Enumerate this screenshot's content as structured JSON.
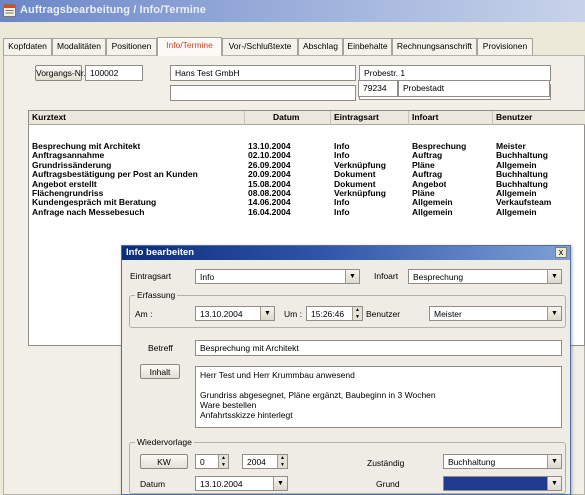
{
  "window": {
    "title": "Auftragsbearbeitung / Info/Termine"
  },
  "tabs": [
    {
      "label": "Kopfdaten"
    },
    {
      "label": "Modalitäten"
    },
    {
      "label": "Positionen"
    },
    {
      "label": "Info/Termine"
    },
    {
      "label": "Vor-/Schlußtexte"
    },
    {
      "label": "Abschlag"
    },
    {
      "label": "Einbehalte"
    },
    {
      "label": "Rechnungsanschrift"
    },
    {
      "label": "Provisionen"
    }
  ],
  "header": {
    "vorgang_button": "Vorgangs-Nr.",
    "vorgang_number": "100002",
    "customer_name": "Hans Test GmbH",
    "customer_line2": "",
    "street": "Probestr. 1",
    "street2": "",
    "zip": "79234",
    "city": "Probestadt"
  },
  "list": {
    "columns": [
      "Kurztext",
      "Datum",
      "Eintragsart",
      "Infoart",
      "Benutzer"
    ],
    "rows": [
      [
        "Besprechung mit Architekt",
        "13.10.2004",
        "Info",
        "Besprechung",
        "Meister"
      ],
      [
        "Anftragsannahme",
        "02.10.2004",
        "Info",
        "Auftrag",
        "Buchhaltung"
      ],
      [
        "Grundrissänderung",
        "26.09.2004",
        "Verknüpfung",
        "Pläne",
        "Allgemein"
      ],
      [
        "Auftragsbestätigung per Post an Kunden",
        "20.09.2004",
        "Dokument",
        "Auftrag",
        "Buchhaltung"
      ],
      [
        "Angebot erstellt",
        "15.08.2004",
        "Dokument",
        "Angebot",
        "Buchhaltung"
      ],
      [
        "Flächengrundriss",
        "08.08.2004",
        "Verknüpfung",
        "Pläne",
        "Allgemein"
      ],
      [
        "Kundengespräch mit Beratung",
        "14.06.2004",
        "Info",
        "Allgemein",
        "Verkaufsteam"
      ],
      [
        "Anfrage nach Messebesuch",
        "16.04.2004",
        "Info",
        "Allgemein",
        "Allgemein"
      ]
    ]
  },
  "dialog": {
    "title": "Info bearbeiten",
    "close": "x",
    "eintragsart_label": "Eintragsart",
    "eintragsart_value": "Info",
    "infoart_label": "Infoart",
    "infoart_value": "Besprechung",
    "erfassung_title": "Erfassung",
    "am_label": "Am :",
    "am_value": "13.10.2004",
    "um_label": "Um :",
    "um_value": "15:26:46",
    "benutzer_label": "Benutzer",
    "benutzer_value": "Meister",
    "betreff_label": "Betreff",
    "betreff_value": "Besprechung mit Architekt",
    "inhalt_button": "Inhalt",
    "inhalt_lines": [
      "Herr Test und Herr Krummbau anwesend",
      "",
      "Grundriss abgesegnet, Pläne ergänzt, Baubeginn in 3 Wochen",
      "Ware bestellen",
      "Anfahrtsskizze hinterlegt"
    ],
    "wiedervorlage_title": "Wiedervorlage",
    "kw_button": "KW",
    "kw_value": "0",
    "year_value": "2004",
    "zustaendig_label": "Zuständig",
    "zustaendig_value": "Buchhaltung",
    "datum_label": "Datum",
    "datum_value": "13.10.2004",
    "grund_label": "Grund",
    "grund_value": ""
  },
  "colors": {
    "active_tab_text": "#d6402a",
    "dialog_title_bar": "#0d2c7a",
    "grund_fill": "#1f3a8f"
  },
  "icons": {
    "app": "app-window-icon",
    "dropdown": "chevron-down-icon",
    "spinner": "spin-updown-icon",
    "close": "close-icon"
  }
}
